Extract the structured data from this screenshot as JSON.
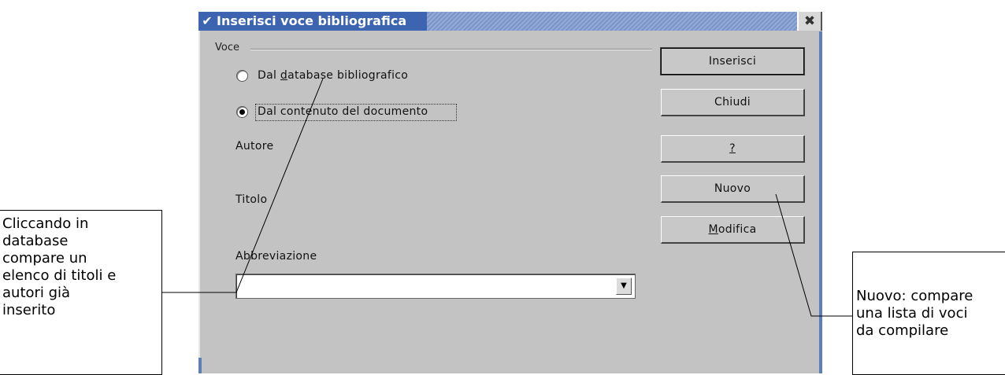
{
  "dialog": {
    "title": "Inserisci voce bibliografica",
    "menu_icon": "chevron-down-icon",
    "close_icon": "close-icon",
    "group_label": "Voce",
    "radio_database": {
      "pre": "Dal ",
      "accel": "d",
      "post": "atabase bibliografico",
      "selected": false
    },
    "radio_document": {
      "label": "Dal contenuto del documento",
      "selected": true
    },
    "author_label": "Autore",
    "title_label": "Titolo",
    "abbrev_label": "Abbreviazione",
    "abbrev_value": "",
    "buttons": {
      "insert": "Inserisci",
      "close": "Chiudi",
      "help": "?",
      "new": "Nuovo",
      "modify_accel": "M",
      "modify_rest": "odifica"
    }
  },
  "callouts": {
    "left": [
      "Cliccando in",
      "database",
      "compare un",
      "elenco di titoli e",
      "autori già",
      "inserito"
    ],
    "right": [
      "Nuovo: compare",
      "una lista di voci",
      "da compilare"
    ]
  },
  "colors": {
    "dialog_bg": "#c3c3c3",
    "title_bar": "#3d64b0"
  }
}
